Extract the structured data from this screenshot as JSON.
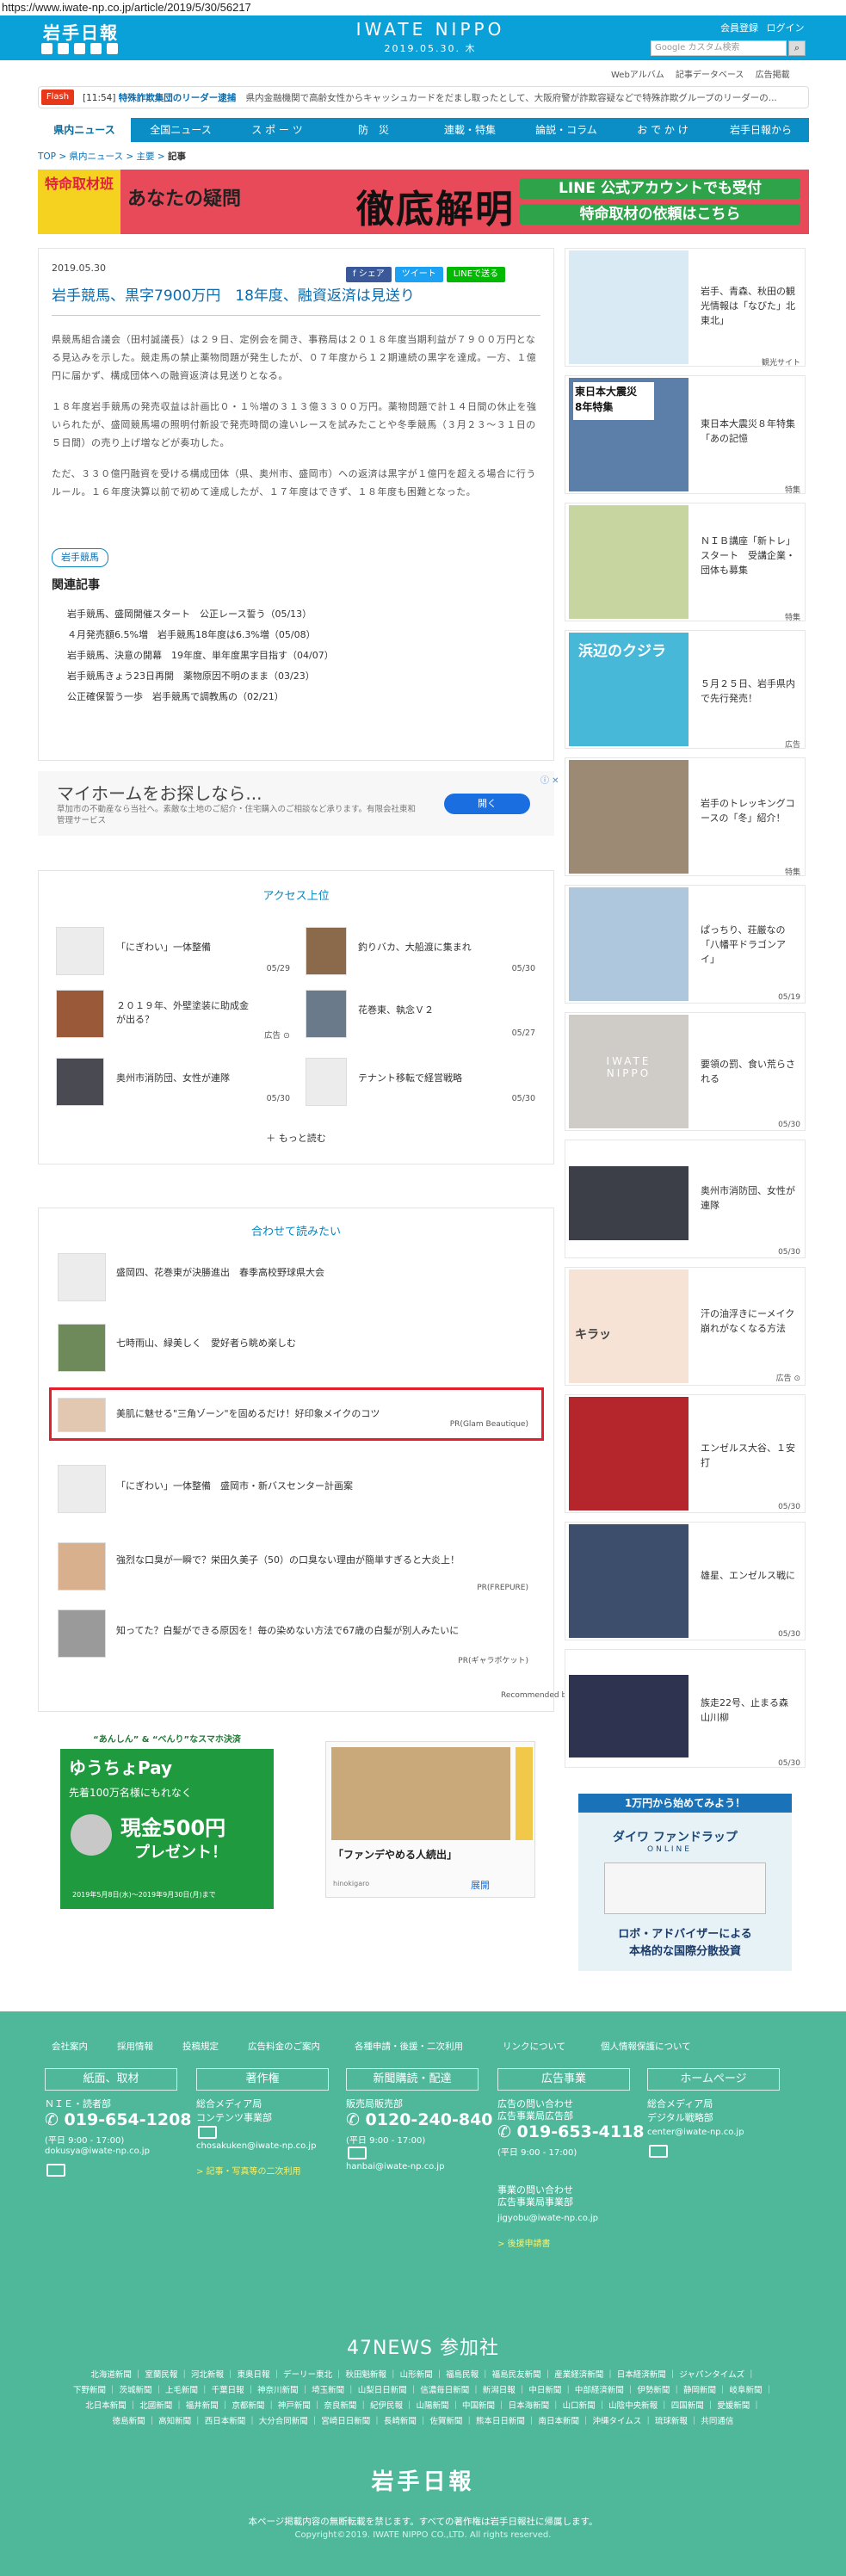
{
  "url": "https://www.iwate-np.co.jp/article/2019/5/30/56217",
  "header": {
    "logo": "岩手日報",
    "site_name": "IWATE NIPPO",
    "date": "2019.05.30. 木",
    "member_register": "会員登録",
    "login": "ログイン",
    "search_placeholder": "Google カスタム検索",
    "subnav": [
      "Webアルバム",
      "記事データベース",
      "広告掲載"
    ]
  },
  "flash": {
    "tag": "Flash",
    "time": "[11:54]",
    "headline": "特殊詐欺集団のリーダー逮捕",
    "body": "県内金融機関で高齢女性からキャッシュカードをだまし取ったとして、大阪府警が詐欺容疑などで特殊詐欺グループのリーダーの..."
  },
  "gnav": [
    "県内ニュース",
    "全国ニュース",
    "ス ポ ー ツ",
    "防　災",
    "連載・特集",
    "論説・コラム",
    "お で か け",
    "岩手日報から"
  ],
  "breadcrumb": {
    "top": "TOP",
    "sep": ">",
    "local": "県内ニュース",
    "main": "主要",
    "current": "記事"
  },
  "banner": {
    "left": "特命取材班",
    "mid": "あなたの疑問",
    "big": "徹底解明",
    "line1": "LINE 公式アカウントでも受付",
    "line2": "特命取材の依頼はこちら"
  },
  "article": {
    "date": "2019.05.30",
    "share": [
      "f シェア",
      "ツイート",
      "LINEで送る"
    ],
    "title": "岩手競馬、黒字7900万円　18年度、融資返済は見送り",
    "paragraphs": [
      "県競馬組合議会（田村誠議長）は２９日、定例会を開き、事務局は２０１８年度当期利益が７９００万円となる見込みを示した。競走馬の禁止薬物問題が発生したが、０７年度から１２期連続の黒字を達成。一方、１億円に届かず、構成団体への融資返済は見送りとなる。",
      "１８年度岩手競馬の発売収益は計画比０・１％増の３１３億３３００万円。薬物問題で計１４日間の休止を強いられたが、盛岡競馬場の照明付新設で発売時間の違いレースを試みたことや冬季競馬（３月２３〜３１日の５日間）の売り上げ増などが奏功した。",
      "ただ、３３０億円融資を受ける構成団体（県、奥州市、盛岡市）への返済は黒字が１億円を超える場合に行うルール。１６年度決算以前で初めて達成したが、１７年度はできず、１８年度も困難となった。"
    ],
    "tag": "岩手競馬",
    "related_title": "関連記事",
    "related": [
      "岩手競馬、盛岡開催スタート　公正レース誓う（05/13）",
      "４月発売額6.5%増　岩手競馬18年度は6.3%増（05/08）",
      "岩手競馬、決意の開幕　19年度、単年度黒字目指す（04/07）",
      "岩手競馬きょう23日再開　薬物原因不明のまま（03/23）",
      "公正確保誓う一歩　岩手競馬で調教馬の（02/21）"
    ]
  },
  "ad": {
    "title": "マイホームをお探しなら...",
    "sub": "草加市の不動産なら当社へ。素敵な土地のご紹介・住宅購入のご相談など承ります。有限会社東和管理サービス",
    "button": "開く",
    "close": "ⓘ ✕"
  },
  "access": {
    "title": "アクセス上位",
    "items": [
      {
        "title": "「にぎわい」一体整備",
        "date": "05/29"
      },
      {
        "title": "釣りバカ、大船渡に集まれ",
        "date": "05/30"
      },
      {
        "title": "２０１９年、外壁塗装に助成金が出る？",
        "date": "広告 ⊙"
      },
      {
        "title": "花巻東、執念Ｖ２",
        "date": "05/27"
      },
      {
        "title": "奥州市消防団、女性が連隊",
        "date": "05/30"
      },
      {
        "title": "テナント移転で経営戦略",
        "date": "05/30"
      }
    ],
    "more": "もっと読む"
  },
  "together": {
    "title": "合わせて読みたい",
    "items": [
      {
        "title": "盛岡四、花巻東が決勝進出　春季高校野球県大会",
        "source": ""
      },
      {
        "title": "七時雨山、緑美しく　愛好者ら眺め楽しむ",
        "source": ""
      },
      {
        "title": "美肌に魅せる\"三角ゾーン\"を固めるだけ！好印象メイクのコツ",
        "source": "PR(Glam Beautique)"
      },
      {
        "title": "「にぎわい」一体整備　盛岡市・新バスセンター計画案",
        "source": ""
      },
      {
        "title": "強烈な口臭が一瞬で？栄田久美子（50）の口臭ない理由が簡単すぎると大炎上！",
        "source": "PR(FREPURE)"
      },
      {
        "title": "知ってた？白髪ができる原因を！毎の染めない方法で67歳の白髪が別人みたいに",
        "source": "PR(ギャラポケット)"
      }
    ],
    "recommended": "Recommended by",
    "brand": "uzou"
  },
  "bottom_ads": {
    "yucho": {
      "top": "“あんしん” & “べんり”なスマホ決済",
      "name": "ゆうちょPay",
      "mid": "先着100万名様にもれなく",
      "cash": "現金500円",
      "gift": "プレゼント！",
      "period": "2019年5月8日(水)〜2019年9月30日(月)まで"
    },
    "furniture": {
      "caption": "「ファンデやめる人続出」",
      "brand": "hinokigaro",
      "link": "展開"
    },
    "daiwa": {
      "head": "1万円から始めてみよう！",
      "name": "ダイワ ファンドラップ",
      "online": "ONLINE",
      "foot1": "ロボ・アドバイザーによる",
      "foot2": "本格的な国際分散投資"
    }
  },
  "sidebar": [
    {
      "text": "岩手、青森、秋田の観光情報は「なびた」北東北」",
      "date": "観光サイト"
    },
    {
      "text": "東日本大震災８年特集「あの記憶",
      "date": "特集"
    },
    {
      "text": "ＮＩＢ講座「新トレ」スタート　受講企業・団体も募集",
      "date": "特集"
    },
    {
      "text": "５月２５日、岩手県内で先行発売！",
      "date": "広告"
    },
    {
      "text": "岩手のトレッキングコースの「冬」紹介！",
      "date": "特集"
    },
    {
      "text": "ぱっちり、荘厳なの「八幡平ドラゴンアイ」",
      "date": "05/19"
    },
    {
      "text": "要領の罰、食い荒らされる",
      "date": "05/30"
    },
    {
      "text": "奥州市消防団、女性が連隊",
      "date": "05/30"
    },
    {
      "text": "汗の油浮きにーメイク崩れがなくなる方法",
      "date": "広告 ⊙"
    },
    {
      "text": "エンゼルス大谷、１安打",
      "date": "05/30"
    },
    {
      "text": "雄星、エンゼルス戦に",
      "date": "05/30"
    },
    {
      "text": "族走22号、止まる森山川柳",
      "date": "05/30"
    }
  ],
  "sidebar_misc": {
    "comic_text": "キラッ",
    "whale_title": "浜辺のクジラ",
    "quake_title": "東日本大震災\n8年特集",
    "iwate_logo": "IWATE\nNIPPO"
  },
  "footer": {
    "links": [
      "会社案内",
      "採用情報",
      "投稿規定",
      "広告料金のご案内",
      "各種申請・後援・二次利用",
      "リンクについて",
      "個人情報保護について"
    ],
    "cats": [
      "紙面、取材",
      "著作権",
      "新聞購読・配達",
      "広告事業",
      "ホームページ"
    ],
    "col1": {
      "sub": "ＮＩＥ・読者部",
      "phone": "019-654-1208",
      "hours": "(平日 9:00 - 17:00)",
      "mail": "dokusya@iwate-np.co.jp"
    },
    "col2": {
      "sub1": "総合メディア局",
      "sub2": "コンテンツ事業部",
      "mail": "chosakuken@iwate-np.co.jp",
      "link": "> 記事・写真等の二次利用"
    },
    "col3": {
      "sub": "販売局販売部",
      "phone": "0120-240-840",
      "hours": "(平日 9:00 - 17:00)",
      "mail": "hanbai@iwate-np.co.jp"
    },
    "col4": {
      "sub1": "広告の問い合わせ",
      "sub2": "広告事業局広告部",
      "phone": "019-653-4118",
      "hours": "(平日 9:00 - 17:00)",
      "sub3": "事業の問い合わせ",
      "sub4": "広告事業局事業部",
      "mail": "jigyobu@iwate-np.co.jp",
      "link": "> 後援申請書"
    },
    "col5": {
      "sub1": "総合メディア局",
      "sub2": "デジタル戦略部",
      "mail": "center@iwate-np.co.jp"
    },
    "news47": "47NEWS 参加社",
    "papers1": "北海道新聞 ｜ 室蘭民報 ｜ 河北新報 ｜ 東奥日報 ｜ デーリー東北 ｜ 秋田魁新報 ｜ 山形新聞 ｜ 福島民報 ｜ 福島民友新聞 ｜ 産業経済新聞 ｜ 日本経済新聞 ｜ ジャパンタイムズ ｜",
    "papers2": "下野新聞 ｜ 茨城新聞 ｜ 上毛新聞 ｜ 千葉日報 ｜ 神奈川新聞 ｜ 埼玉新聞 ｜ 山梨日日新聞 ｜ 信濃毎日新聞 ｜ 新潟日報 ｜ 中日新聞 ｜ 中部経済新聞 ｜ 伊勢新聞 ｜ 静岡新聞 ｜ 岐阜新聞 ｜",
    "papers3": "北日本新聞 ｜ 北國新聞 ｜ 福井新聞 ｜ 京都新聞 ｜ 神戸新聞 ｜ 奈良新聞 ｜ 紀伊民報 ｜ 山陽新聞 ｜ 中国新聞 ｜ 日本海新聞 ｜ 山口新聞 ｜ 山陰中央新報 ｜ 四国新聞 ｜ 愛媛新聞 ｜",
    "papers4": "徳島新聞 ｜ 高知新聞 ｜ 西日本新聞 ｜ 大分合同新聞 ｜ 宮崎日日新聞 ｜ 長崎新聞 ｜ 佐賀新聞 ｜ 熊本日日新聞 ｜ 南日本新聞 ｜ 沖縄タイムス ｜ 琉球新報 ｜ 共同通信",
    "logo": "岩手日報",
    "note": "本ページ掲載内容の無断転載を禁じます。すべての著作権は岩手日報社に帰属します。",
    "copyright": "Copyright©2019. IWATE NIPPO CO.,LTD. All rights reserved."
  }
}
